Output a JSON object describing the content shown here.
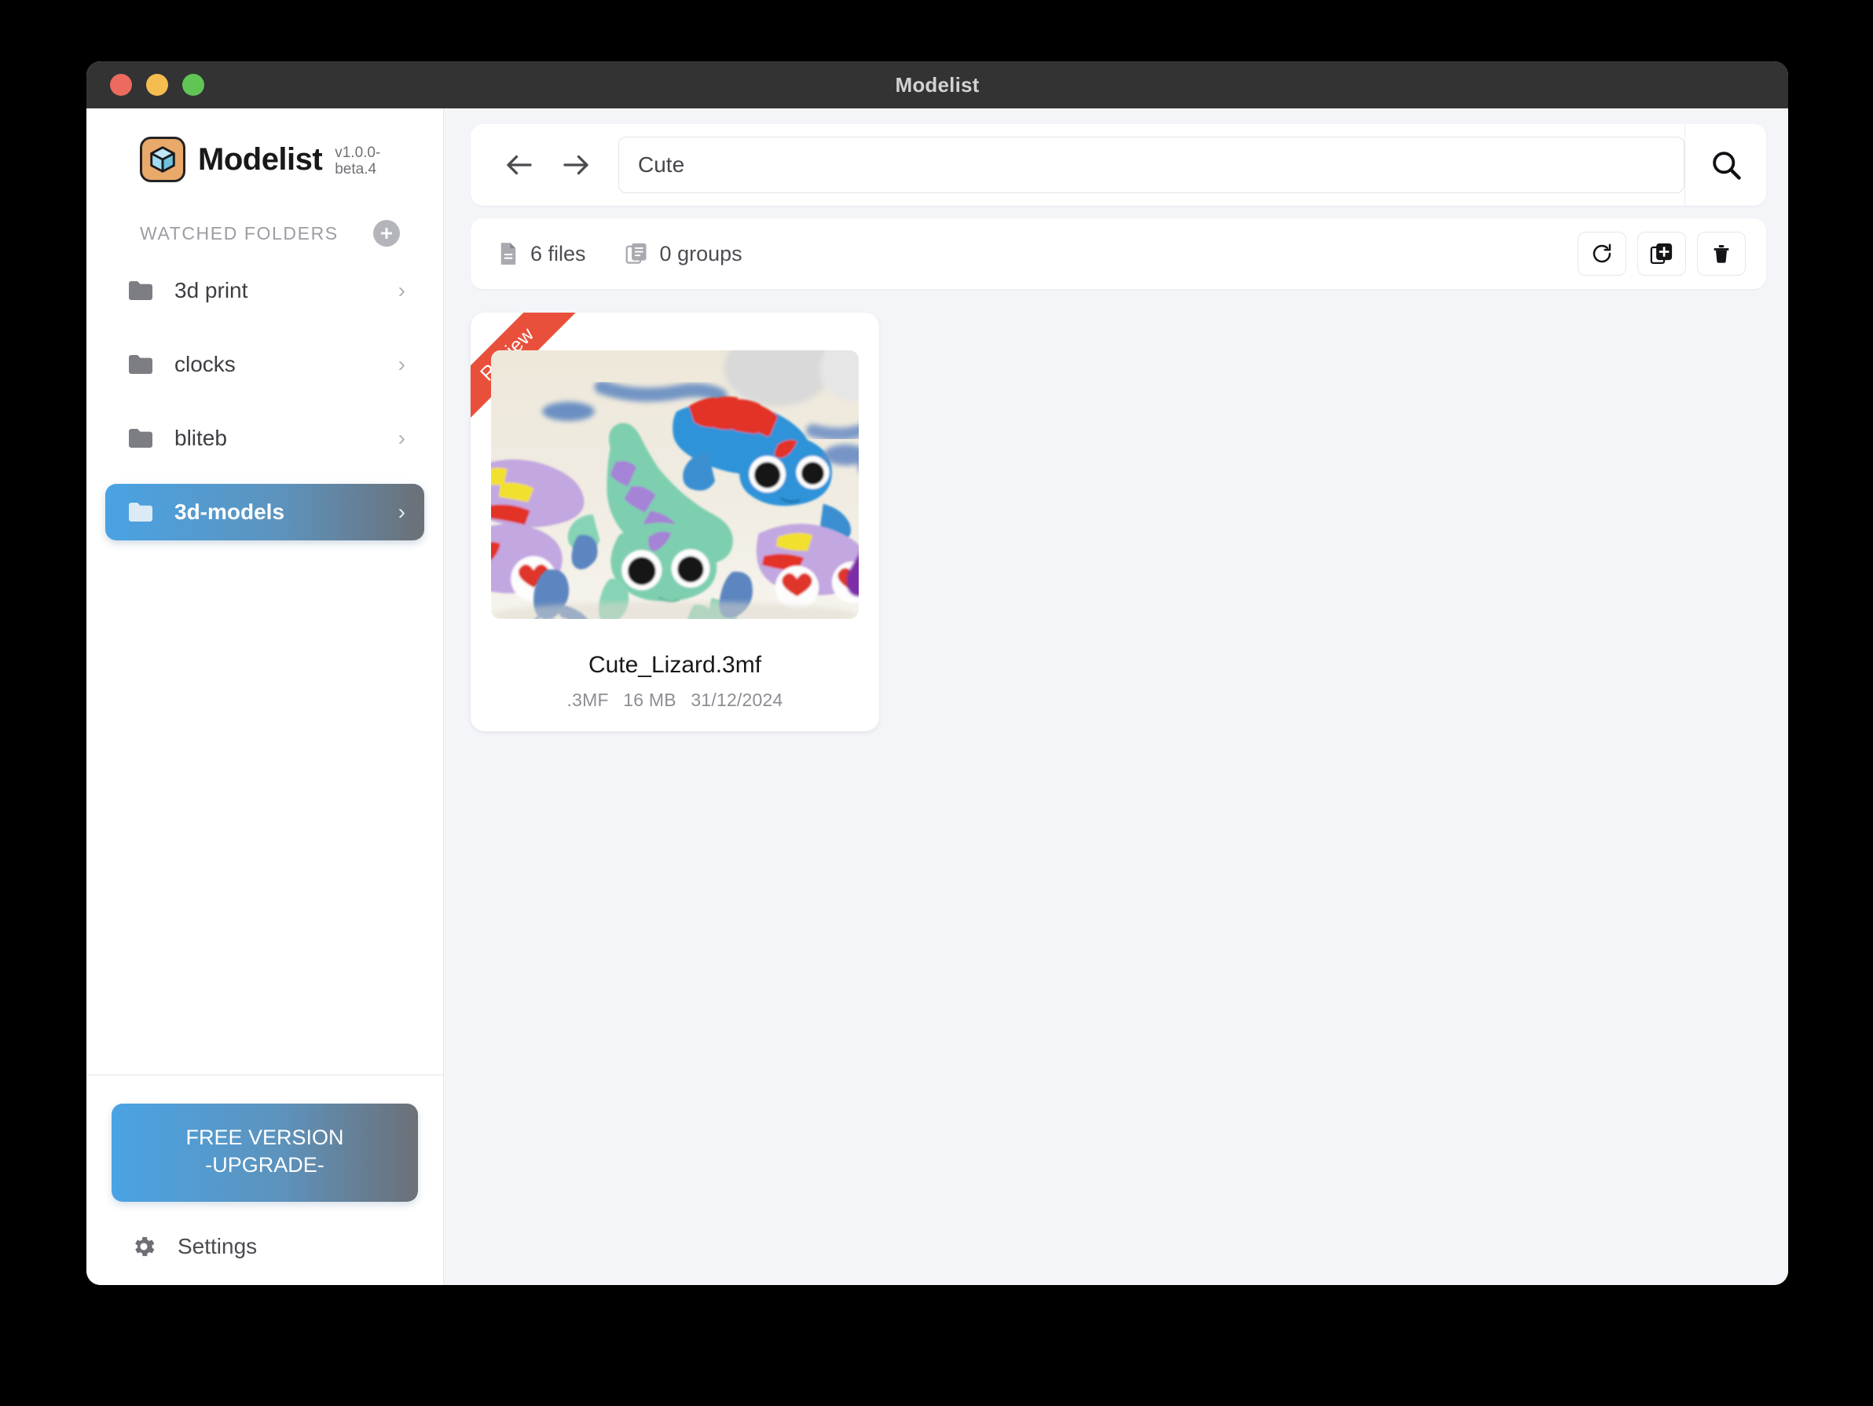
{
  "window": {
    "title": "Modelist",
    "traffic_lights": [
      "close",
      "minimize",
      "zoom"
    ]
  },
  "sidebar": {
    "brand_name": "Modelist",
    "version": "v1.0.0-beta.4",
    "logo_icon": "cube-icon",
    "section_title": "WATCHED FOLDERS",
    "add_folder_icon": "plus-circle-icon",
    "folders": [
      {
        "label": "3d print",
        "icon": "folder-icon",
        "chevron": "›",
        "selected": false
      },
      {
        "label": "clocks",
        "icon": "folder-icon",
        "chevron": "›",
        "selected": false
      },
      {
        "label": "bliteb",
        "icon": "folder-icon",
        "chevron": "›",
        "selected": false
      },
      {
        "label": "3d-models",
        "icon": "folder-icon",
        "chevron": "›",
        "selected": true
      }
    ],
    "upgrade_line1": "FREE VERSION",
    "upgrade_line2": "-UPGRADE-",
    "settings_label": "Settings",
    "settings_icon": "gear-icon"
  },
  "search": {
    "back_icon": "arrow-left-icon",
    "forward_icon": "arrow-right-icon",
    "value": "Cute",
    "placeholder": "Search",
    "submit_icon": "search-icon"
  },
  "stats": {
    "files_label": "6 files",
    "files_icon": "file-icon",
    "groups_label": "0 groups",
    "groups_icon": "copy-stack-icon",
    "actions": [
      {
        "name": "refresh-button",
        "icon": "refresh-icon"
      },
      {
        "name": "add-group-button",
        "icon": "add-square-icon"
      },
      {
        "name": "delete-button",
        "icon": "trash-icon"
      }
    ]
  },
  "files": [
    {
      "name": "Cute_Lizard.3mf",
      "badge": "Review",
      "format": ".3MF",
      "size": "16 MB",
      "date": "31/12/2024",
      "thumbnail_alt": "3D printed articulated lizards in blue, mint green and lavender with red, yellow and purple stripes"
    }
  ],
  "colors": {
    "accent_blue": "#4aa3e4",
    "badge_red": "#e8503c",
    "logo_orange": "#e9a96b",
    "titlebar": "#333334",
    "content_bg": "#f4f5f9"
  }
}
